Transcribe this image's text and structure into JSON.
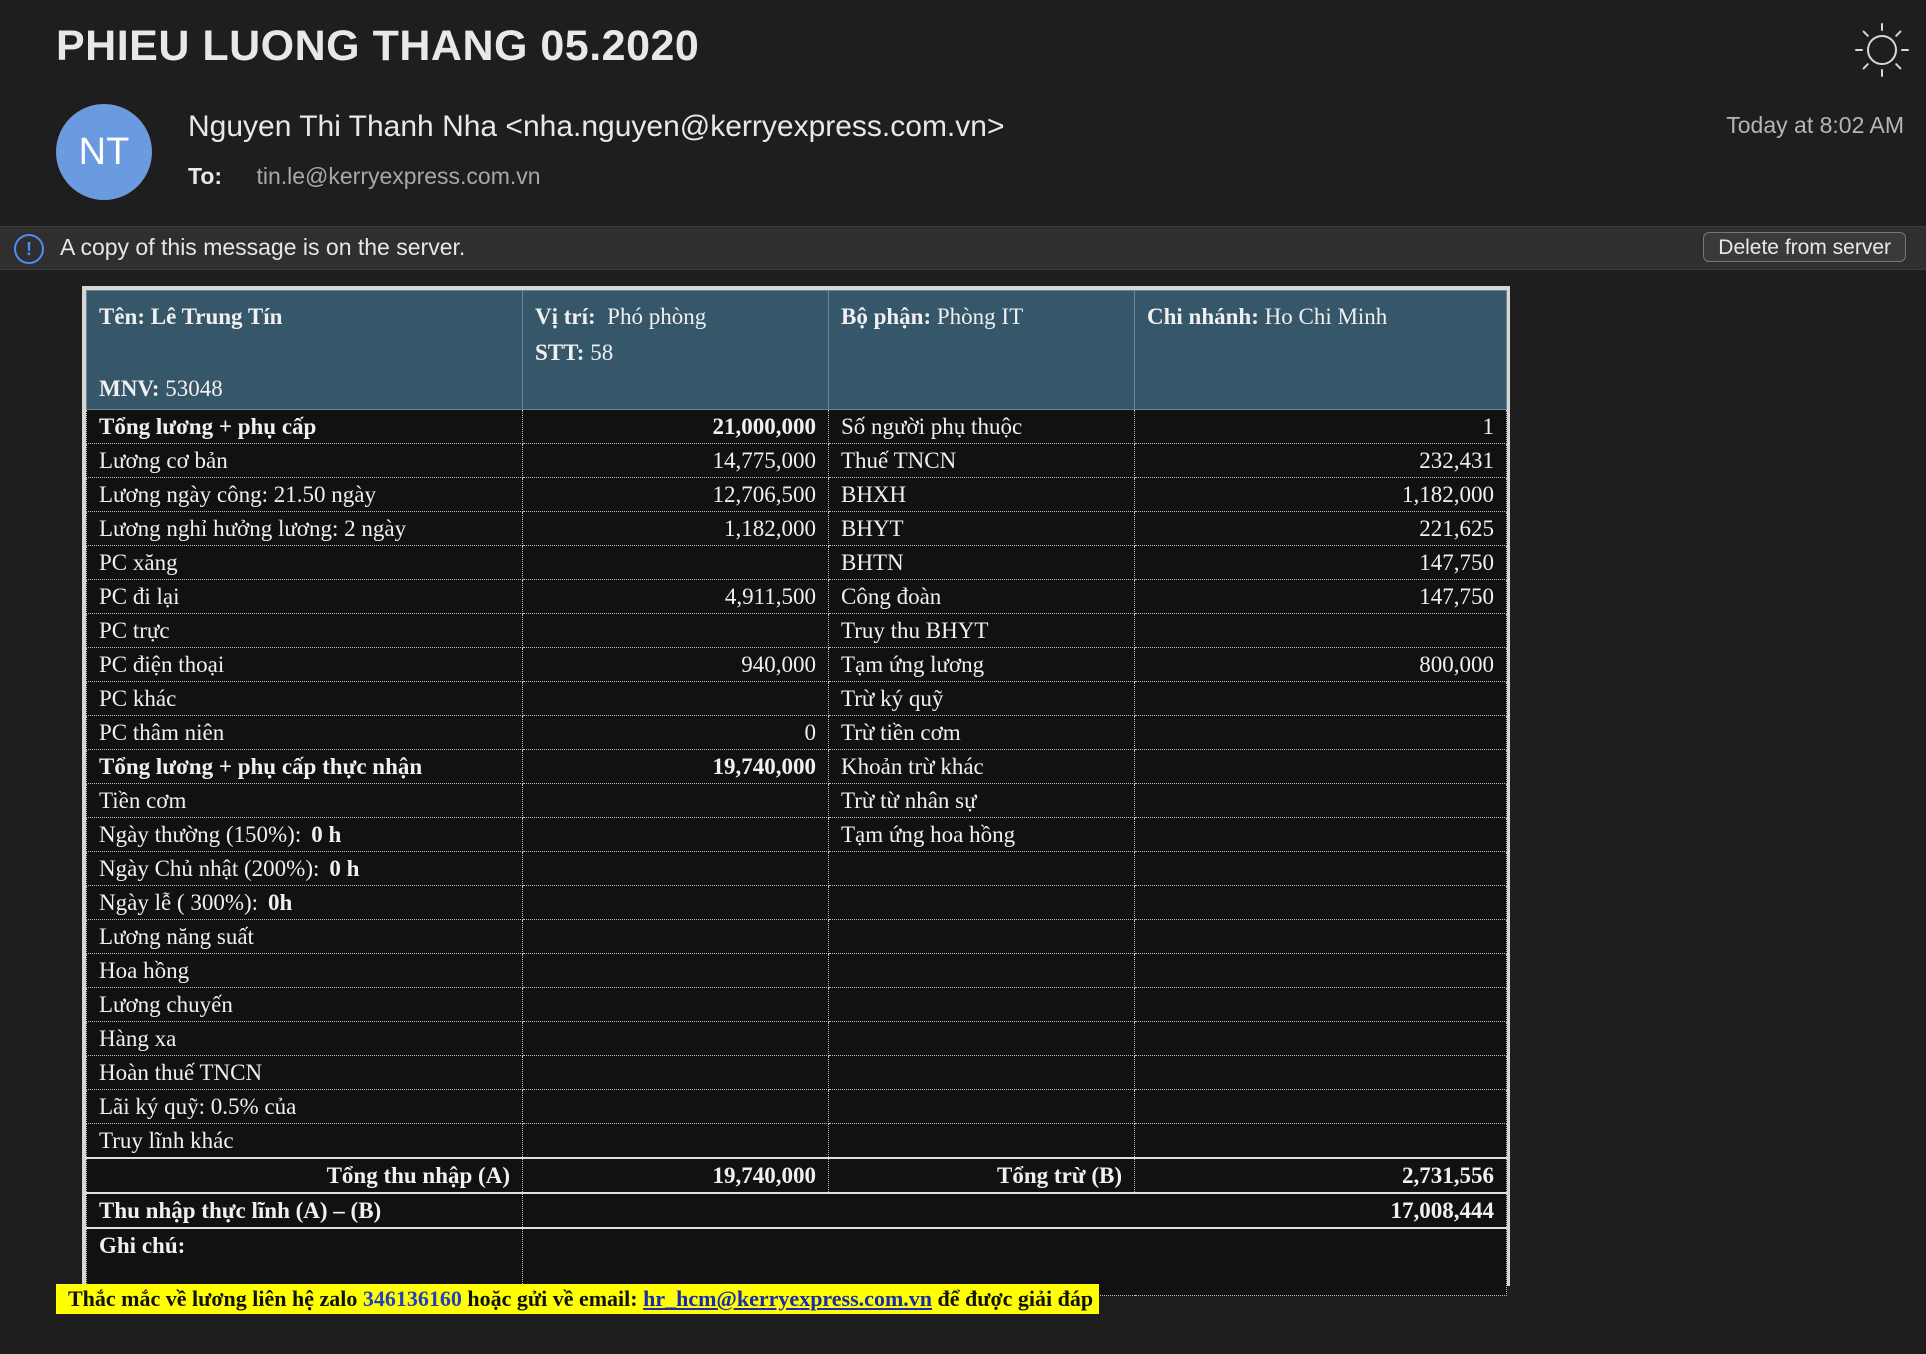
{
  "email": {
    "subject": "PHIEU LUONG THANG 05.2020",
    "avatar_initials": "NT",
    "sender": "Nguyen Thi Thanh Nha <nha.nguyen@kerryexpress.com.vn>",
    "to_label": "To:",
    "to_address": "tin.le@kerryexpress.com.vn",
    "date": "Today at 8:02 AM",
    "banner_text": "A copy of this message is on the server.",
    "delete_button": "Delete from server",
    "icons": [
      "sun-icon",
      "info-icon"
    ],
    "colors": {
      "avatar": "#6a9ae0",
      "header_band": "#36566a",
      "footer_highlight": "#ffff00"
    }
  },
  "payslip": {
    "header": {
      "name_label": "Tên:",
      "name": "Lê Trung Tín",
      "mnv_label": "MNV:",
      "mnv": "53048",
      "position_label": "Vị trí:",
      "position": "Phó phòng",
      "stt_label": "STT:",
      "stt": "58",
      "dept_label": "Bộ phận:",
      "dept": "Phòng IT",
      "branch_label": "Chi nhánh:",
      "branch": "Ho Chi Minh"
    },
    "rows": [
      {
        "l": "Tổng lương + phụ cấp",
        "lv": "21,000,000",
        "r": "Số người phụ thuộc",
        "rv": "1",
        "bold": true
      },
      {
        "l": "Lương cơ bản",
        "lv": "14,775,000",
        "r": "Thuế TNCN",
        "rv": "232,431"
      },
      {
        "l": "Lương ngày công:  21.50 ngày",
        "lv": "12,706,500",
        "r": "BHXH",
        "rv": "1,182,000"
      },
      {
        "l": "Lương nghỉ hưởng lương:  2 ngày",
        "lv": "1,182,000",
        "r": "BHYT",
        "rv": "221,625"
      },
      {
        "l": "PC xăng",
        "lv": "",
        "r": "BHTN",
        "rv": "147,750"
      },
      {
        "l": "PC đi lại",
        "lv": "4,911,500",
        "r": "Công đoàn",
        "rv": "147,750"
      },
      {
        "l": "PC trực",
        "lv": "",
        "r": "Truy thu BHYT",
        "rv": ""
      },
      {
        "l": "PC điện thoại",
        "lv": "940,000",
        "r": "Tạm ứng lương",
        "rv": "800,000"
      },
      {
        "l": "PC khác",
        "lv": "",
        "r": "Trừ ký quỹ",
        "rv": ""
      },
      {
        "l": "PC thâm niên",
        "lv": "0",
        "r": "Trừ tiền cơm",
        "rv": ""
      },
      {
        "l": "Tổng lương + phụ cấp thực nhận",
        "lv": "19,740,000",
        "r": "Khoản trừ khác",
        "rv": "",
        "bold": true
      },
      {
        "l": "Tiền cơm",
        "lv": "",
        "r": "Trừ từ nhân sự",
        "rv": ""
      },
      {
        "l": "Ngày thường (150%):",
        "lh": "0 h",
        "lv": "",
        "r": "Tạm ứng hoa hồng",
        "rv": ""
      },
      {
        "l": "Ngày Chủ nhật (200%):",
        "lh": "0 h",
        "lv": "",
        "r": "",
        "rv": ""
      },
      {
        "l": "Ngày lễ ( 300%):",
        "lh": "0h",
        "lv": "",
        "r": "",
        "rv": ""
      },
      {
        "l": "Lương năng suất",
        "lv": "",
        "r": "",
        "rv": ""
      },
      {
        "l": "Hoa hồng",
        "lv": "",
        "r": "",
        "rv": ""
      },
      {
        "l": "Lương chuyến",
        "lv": "",
        "r": "",
        "rv": ""
      },
      {
        "l": "Hàng xa",
        "lv": "",
        "r": "",
        "rv": ""
      },
      {
        "l": "Hoàn thuế TNCN",
        "lv": "",
        "r": "",
        "rv": ""
      },
      {
        "l": "Lãi ký quỹ: 0.5% của",
        "lv": "",
        "r": "",
        "rv": ""
      },
      {
        "l": "Truy lĩnh khác",
        "lv": "",
        "r": "",
        "rv": ""
      }
    ],
    "totals": {
      "income_label": "Tổng thu nhập (A)",
      "income": "19,740,000",
      "deduct_label": "Tổng trừ (B)",
      "deduct": "2,731,556",
      "net_label": "Thu nhập thực lĩnh (A) – (B)",
      "net": "17,008,444",
      "note_label": "Ghi chú:"
    }
  },
  "footer": {
    "prefix": "Thắc mắc về lương liên hệ zalo ",
    "zalo": "346136160",
    "middle": " hoặc gửi về email: ",
    "email": "hr_hcm@kerryexpress.com.vn",
    "suffix": " để được giải đáp"
  }
}
